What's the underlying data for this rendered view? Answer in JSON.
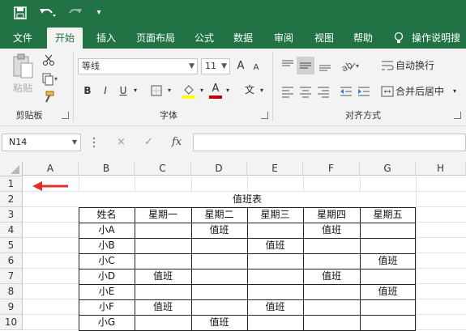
{
  "quick_access": {
    "save_icon": "save-icon",
    "undo_icon": "undo-icon",
    "redo_icon": "redo-icon",
    "customize_icon": "customize-qat-icon"
  },
  "tabs": [
    "文件",
    "开始",
    "插入",
    "页面布局",
    "公式",
    "数据",
    "审阅",
    "视图",
    "帮助"
  ],
  "active_tab": "开始",
  "tell_me": "操作说明搜",
  "ribbon": {
    "clipboard": {
      "paste_label": "粘贴",
      "group_label": "剪贴板"
    },
    "font": {
      "font_name": "等线",
      "font_size": "11",
      "group_label": "字体",
      "bold": "B",
      "italic": "I",
      "underline": "U",
      "grow": "A",
      "shrink": "A",
      "font_color_letter": "A",
      "phonetic": "文"
    },
    "alignment": {
      "wrap_text": "自动换行",
      "merge_center": "合并后居中",
      "group_label": "对齐方式"
    }
  },
  "formula_bar": {
    "name_box": "N14",
    "cancel": "×",
    "enter": "✓",
    "fx": "fx"
  },
  "columns": [
    "A",
    "B",
    "C",
    "D",
    "E",
    "F",
    "G",
    "H"
  ],
  "rows": [
    "1",
    "2",
    "3",
    "4",
    "5",
    "6",
    "7",
    "8",
    "9",
    "10"
  ],
  "sheet": {
    "title": "值班表",
    "header": [
      "姓名",
      "星期一",
      "星期二",
      "星期三",
      "星期四",
      "星期五"
    ],
    "body": [
      [
        "小A",
        "",
        "值班",
        "",
        "值班",
        ""
      ],
      [
        "小B",
        "",
        "",
        "值班",
        "",
        ""
      ],
      [
        "小C",
        "",
        "",
        "",
        "",
        "值班"
      ],
      [
        "小D",
        "值班",
        "",
        "",
        "值班",
        ""
      ],
      [
        "小E",
        "",
        "",
        "",
        "",
        "值班"
      ],
      [
        "小F",
        "值班",
        "",
        "值班",
        "",
        ""
      ],
      [
        "小G",
        "",
        "值班",
        "",
        "",
        ""
      ]
    ]
  },
  "colors": {
    "excel_green": "#217346",
    "arrow_red": "#e0302e",
    "font_color": "#c00000",
    "highlight": "#ffff00"
  }
}
